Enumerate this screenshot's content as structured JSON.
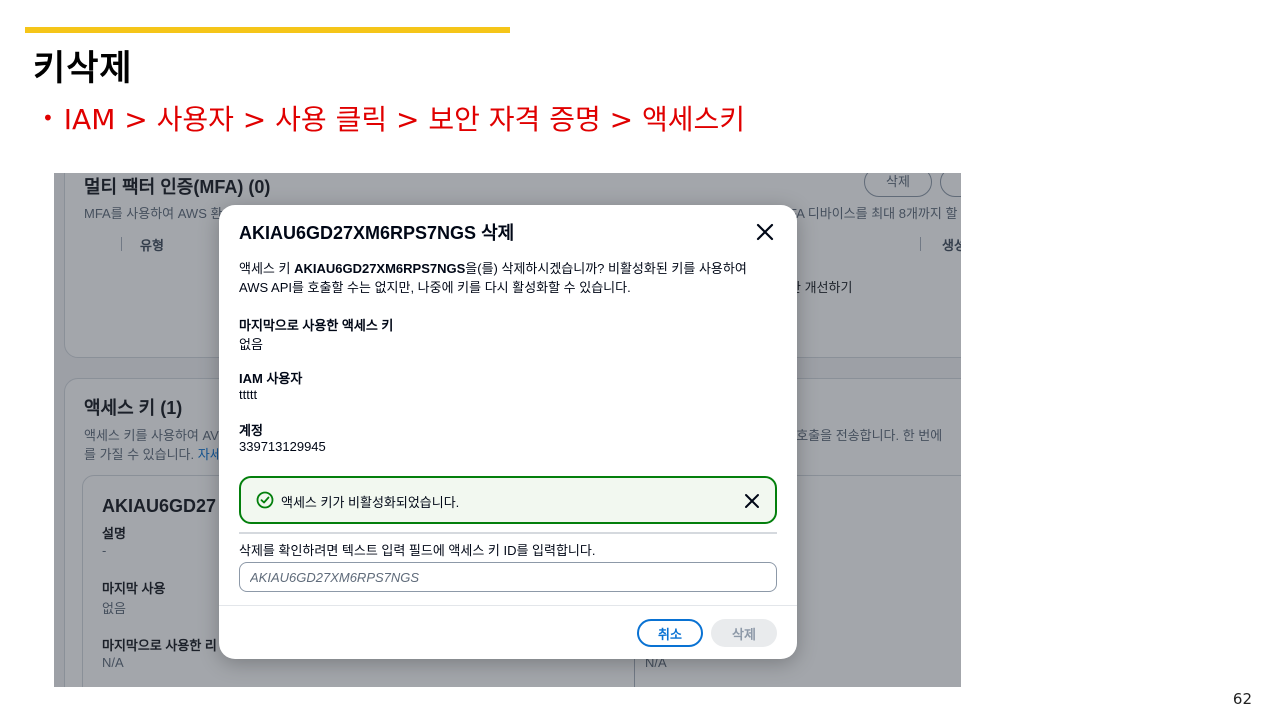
{
  "slide": {
    "title": "키삭제",
    "breadcrumb": "IAM > 사용자 > 사용 클릭 > 보안 자격 증명 > 액세스키",
    "bullet": "•",
    "page_number": "62"
  },
  "background": {
    "mfa_title": "멀티 팩터 인증(MFA) (0)",
    "mfa_desc_left": "MFA를 사용하여 AWS 환",
    "mfa_desc_right": "FA 디바이스를 최대 8개까지 할",
    "mfa_delete_btn": "삭제",
    "col_type": "유형",
    "col_created": "생성",
    "improve_text": "한 개선하기",
    "access_title": "액세스 키 (1)",
    "access_desc_left": "액세스 키를 사용하여 AV",
    "access_desc_right": "I 호출을 전송합니다. 한 번에",
    "access_desc_line2": "를 가질 수 있습니다.",
    "access_desc_link": "자세",
    "key_id_truncated": "AKIAU6GD27",
    "desc_label": "설명",
    "desc_value": "-",
    "last_used_label": "마지막 사용",
    "last_used_value": "없음",
    "last_used_region_label": "마지막으로 사용한 리",
    "last_used_region_value": "N/A",
    "right_na": "N/A"
  },
  "modal": {
    "title": "AKIAU6GD27XM6RPS7NGS 삭제",
    "desc_prefix": "액세스 키 ",
    "desc_key": "AKIAU6GD27XM6RPS7NGS",
    "desc_suffix": "을(를) 삭제하시겠습니까? 비활성화된 키를 사용하여 AWS API를 호출할 수는 없지만, 나중에 키를 다시 활성화할 수 있습니다.",
    "last_used_label": "마지막으로 사용한 액세스 키",
    "last_used_value": "없음",
    "iam_user_label": "IAM 사용자",
    "iam_user_value": "ttttt",
    "account_label": "계정",
    "account_value": "339713129945",
    "alert_text": "액세스 키가 비활성화되었습니다.",
    "confirm_text": "삭제를 확인하려면 텍스트 입력 필드에 액세스 키 ID를 입력합니다.",
    "input_placeholder": "AKIAU6GD27XM6RPS7NGS",
    "cancel_label": "취소",
    "delete_label": "삭제"
  },
  "colors": {
    "accent_bar": "#f5c518",
    "breadcrumb": "#e00000",
    "success": "#037f0c",
    "primary": "#0972d3"
  }
}
